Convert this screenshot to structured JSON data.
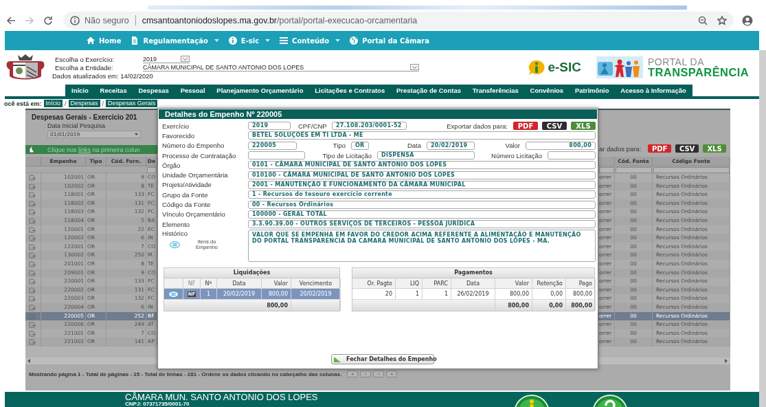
{
  "browser": {
    "security": "Não seguro",
    "url": "cmsantoantoniodoslopes.ma.gov.br/portal/portal-execucao-orcamentaria"
  },
  "top_nav": [
    {
      "label": "Home",
      "dropdown": false
    },
    {
      "label": "Regulamentação",
      "dropdown": true
    },
    {
      "label": "E-sic",
      "dropdown": true
    },
    {
      "label": "Conteúdo",
      "dropdown": true
    },
    {
      "label": "Portal da Câmara",
      "dropdown": false
    }
  ],
  "header": {
    "exercise_label": "Escolha o Exercício:",
    "exercise": "2019",
    "entity_label": "Escolha a Entidade:",
    "entity": "CÂMARA MUNICIPAL DE SANTO ANTONIO DOS LOPES",
    "updated": "Dados atualizados em: 14/02/2020",
    "esic_logo": "e-SIC",
    "portal_logo_top": "PORTAL DA",
    "portal_logo_bottom": "TRANSPARÊNCIA"
  },
  "menu": [
    "Início",
    "Receitas",
    "Despesas",
    "Pessoal",
    "Planejamento Orçamentário",
    "Licitações e Contratos",
    "Prestação de Contas",
    "Transferências",
    "Convênios",
    "Patrimônio",
    "Acesso à Informação"
  ],
  "breadcrumb": [
    {
      "kind": "prefix",
      "text": "ocê está em:"
    },
    {
      "kind": "link",
      "text": "Início"
    },
    {
      "kind": "separator",
      "text": "/"
    },
    {
      "kind": "link",
      "text": "Despesas"
    },
    {
      "kind": "separator",
      "text": "/"
    },
    {
      "kind": "link",
      "text": "Despesas Gerais"
    }
  ],
  "report": {
    "title": "Despesas Gerais - Exercicio 201",
    "date_label": "Data Inicial Pesquisa",
    "date": "01/01/2019",
    "hint": {
      "before": "Clique nos ",
      "link": "links",
      "after": " na primeira colun"
    },
    "export_label": "ar dados para:",
    "export_buttons": [
      {
        "kind": "pdf",
        "label": "PDF"
      },
      {
        "kind": "csv",
        "label": "CSV"
      },
      {
        "kind": "xls",
        "label": "XLS"
      }
    ],
    "table": {
      "left_columns": [
        "Empenho",
        "Tipo",
        "Cód. Forn.",
        "De"
      ],
      "right_columns": [
        "Cód. Fonte",
        "Código Fonte"
      ],
      "rows": [
        {
          "cells": [
            "102001",
            "OR",
            "9",
            "CO",
            "orrer",
            "00",
            "Recursos Ordinários"
          ],
          "selected": false
        },
        {
          "cells": [
            "102002",
            "OR",
            "8",
            "TE",
            "orrer",
            "00",
            "Recursos Ordinários"
          ],
          "selected": false
        },
        {
          "cells": [
            "118001",
            "OR",
            "133",
            "FC",
            "orrer",
            "00",
            "Recursos Ordinários"
          ],
          "selected": false
        },
        {
          "cells": [
            "118002",
            "OR",
            "131",
            "FC",
            "orrer",
            "00",
            "Recursos Ordinários"
          ],
          "selected": false
        },
        {
          "cells": [
            "118003",
            "OR",
            "132",
            "FC",
            "orrer",
            "00",
            "Recursos Ordinários"
          ],
          "selected": false
        },
        {
          "cells": [
            "118004",
            "OR",
            "5",
            "BA",
            "orrer",
            "00",
            "Recursos Ordinários"
          ],
          "selected": false
        },
        {
          "cells": [
            "120001",
            "OR",
            "22",
            "EC",
            "orrer",
            "00",
            "Recursos Ordinários"
          ],
          "selected": false
        },
        {
          "cells": [
            "120002",
            "OR",
            "6",
            "IN",
            "orrer",
            "00",
            "Recursos Ordinários"
          ],
          "selected": false
        },
        {
          "cells": [
            "122001",
            "OR",
            "7",
            "CO",
            "orrer",
            "00",
            "Recursos Ordinários"
          ],
          "selected": false
        },
        {
          "cells": [
            "130002",
            "OR",
            "250",
            "M.",
            "orrer",
            "00",
            "Recursos Ordinários"
          ],
          "selected": false
        },
        {
          "cells": [
            "201001",
            "OR",
            "8",
            "TE",
            "orrer",
            "00",
            "Recursos Ordinários"
          ],
          "selected": false
        },
        {
          "cells": [
            "209001",
            "OR",
            "9",
            "CO",
            "orrer",
            "00",
            "Recursos Ordinários"
          ],
          "selected": false
        },
        {
          "cells": [
            "220001",
            "OR",
            "133",
            "FC",
            "orrer",
            "00",
            "Recursos Ordinários"
          ],
          "selected": false
        },
        {
          "cells": [
            "220002",
            "OR",
            "131",
            "FC",
            "orrer",
            "00",
            "Recursos Ordinários"
          ],
          "selected": false
        },
        {
          "cells": [
            "220003",
            "OR",
            "132",
            "FC",
            "orrer",
            "00",
            "Recursos Ordinários"
          ],
          "selected": false
        },
        {
          "cells": [
            "220004",
            "OR",
            "6",
            "IN",
            "orrer",
            "00",
            "Recursos Ordinários"
          ],
          "selected": false
        },
        {
          "cells": [
            "220005",
            "OR",
            "252",
            "BF",
            "orrer",
            "00",
            "Recursos Ordinários"
          ],
          "selected": true
        },
        {
          "cells": [
            "220006",
            "OR",
            "249",
            "AT",
            "orrer",
            "00",
            "Recursos Ordinários"
          ],
          "selected": false
        },
        {
          "cells": [
            "221001",
            "OR",
            "7",
            "CO",
            "orrer",
            "00",
            "Recursos Ordinários"
          ],
          "selected": false
        },
        {
          "cells": [
            "221002",
            "OR",
            "141",
            "AP",
            "orrer",
            "00",
            "Recursos Ordinários"
          ],
          "selected": false
        }
      ]
    },
    "status": "Mostrando página 1 - Total de páginas - 15 - Total de linhas - 281 - Ordene os dados clicando no cabeçalho das colunas.",
    "pager": [
      "«",
      "‹",
      "›",
      "»"
    ]
  },
  "details": {
    "title": "Detalhes do Empenho Nº 220005",
    "rows": [
      {
        "kind": "exercicio",
        "items": [
          {
            "label": "Exercício",
            "value": "2019"
          },
          {
            "label": "CPF/CNP",
            "value": "27.108.203/0001-52"
          }
        ],
        "export": {
          "label": "Exportar dados para:",
          "buttons": [
            {
              "kind": "pdf",
              "label": "PDF"
            },
            {
              "kind": "csv",
              "label": "CSV"
            },
            {
              "kind": "xls",
              "label": "XLS"
            }
          ]
        }
      },
      {
        "kind": "single",
        "items": [
          {
            "label": "Favorecido",
            "value": "BETEL SOLUÇOES EM TI LTDA - ME"
          }
        ]
      },
      {
        "kind": "numero",
        "items": [
          {
            "label": "Número do Empenho",
            "value": "220005"
          },
          {
            "label": "Tipo",
            "value": "OR"
          },
          {
            "label": "Data",
            "value": "20/02/2019"
          },
          {
            "label": "Valor",
            "value": "800,00"
          }
        ]
      },
      {
        "kind": "processo",
        "items": [
          {
            "label": "Processo de Contratação"
          },
          {
            "label": "Tipo de Licitação",
            "value": "DISPENSA"
          },
          {
            "label": "Número Licitação"
          }
        ]
      },
      {
        "kind": "single",
        "items": [
          {
            "label": "Órgão",
            "value": "0101 - CÂMARA MUNICIPAL DE SANTO ANTONIO DOS LOPES"
          }
        ]
      },
      {
        "kind": "single",
        "items": [
          {
            "label": "Unidade Orçamentária",
            "value": "010100 - CÂMARA MUNICIPAL DE SANTO ANTONIO DOS LOPES"
          }
        ]
      },
      {
        "kind": "single",
        "items": [
          {
            "label": "Projeto/Atividade",
            "value": "2001 - MANUTENÇÃO E FUNCIONAMENTO DA CÂMARA MUNICIPAL"
          }
        ]
      },
      {
        "kind": "single",
        "items": [
          {
            "label": "Grupo da Fonte",
            "value": "1 - Recursos do tesouro exercício corrente"
          }
        ]
      },
      {
        "kind": "single",
        "items": [
          {
            "label": "Código da Fonte",
            "value": "00 - Recursos Ordinários"
          }
        ]
      },
      {
        "kind": "single",
        "items": [
          {
            "label": "Vínculo Orçamentário",
            "value": "100000 - GERAL TOTAL"
          }
        ]
      },
      {
        "kind": "single",
        "items": [
          {
            "label": "Elemento",
            "value": "3.3.90.39.00 - OUTROS SERVIÇOS DE TERCEIROS - PESSOA JURÍDICA"
          }
        ]
      },
      {
        "kind": "historico",
        "items": [
          {
            "label": "Histórico",
            "value": "VALOR QUE SE EMPENHA EM FAVOR DO CREDOR ACIMA REFERENTE A ALIMENTAÇÃO E MANUTENÇÃO DO PORTAL TRANSPARENCIA DA CAMARA MUNICIPAL DE SANTO ANTONIO DOS LOPES - MA."
          }
        ],
        "action": "Itens do Empenho"
      }
    ],
    "liquidacoes": {
      "title": "Liquidações",
      "columns": [
        "NF",
        "Nº",
        "Data",
        "Valor",
        "Vencimento"
      ],
      "rows": [
        {
          "nf": "NF",
          "values": [
            "1",
            "20/02/2019",
            "800,00",
            "20/02/2019"
          ],
          "selected": true
        }
      ],
      "total": "800,00"
    },
    "pagamentos": {
      "title": "Pagamentos",
      "columns": [
        "Or. Pagto",
        "LIQ",
        "PARC",
        "Data",
        "Valor",
        "Retenção",
        "Pago"
      ],
      "rows": [
        {
          "values": [
            "20",
            "1",
            "1",
            "26/02/2019",
            "800,00",
            "0,00",
            "800,00"
          ],
          "selected": false
        }
      ],
      "totals": [
        "800,00",
        "0,00",
        "800,00"
      ]
    },
    "close": "Fechar Detalhes do Empenho"
  },
  "footer": {
    "name": "CÂMARA MUN. SANTO ANTONIO DOS LOPES",
    "cnpj": "CNPJ: 07371735/0001-70"
  }
}
